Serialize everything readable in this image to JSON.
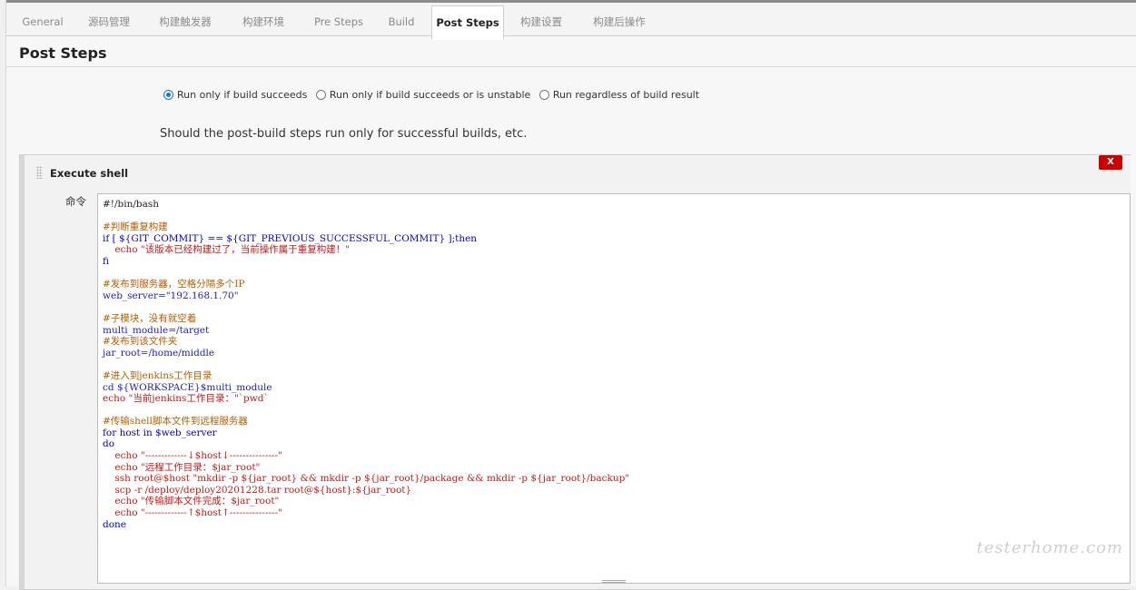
{
  "tabs": [
    {
      "label": "General",
      "active": false
    },
    {
      "label": "源码管理",
      "active": false
    },
    {
      "label": "构建触发器",
      "active": false
    },
    {
      "label": "构建环境",
      "active": false
    },
    {
      "label": "Pre Steps",
      "active": false
    },
    {
      "label": "Build",
      "active": false
    },
    {
      "label": "Post Steps",
      "active": true
    },
    {
      "label": "构建设置",
      "active": false
    },
    {
      "label": "构建后操作",
      "active": false
    }
  ],
  "section": {
    "title": "Post Steps",
    "options": [
      {
        "label": "Run only if build succeeds",
        "checked": true
      },
      {
        "label": "Run only if build succeeds or is unstable",
        "checked": false
      },
      {
        "label": "Run regardless of build result",
        "checked": false
      }
    ],
    "help": "Should the post-build steps run only for successful builds, etc."
  },
  "step": {
    "title": "Execute shell",
    "delete_label": "X",
    "command_label": "命令",
    "script_lines": [
      "#!/bin/bash",
      "",
      "#判断重复构建",
      "if [ ${GIT_COMMIT} == ${GIT_PREVIOUS_SUCCESSFUL_COMMIT} ];then",
      "    echo \"该版本已经构建过了，当前操作属于重复构建！\"",
      "fi",
      "",
      "#发布到服务器，空格分隔多个IP",
      "web_server=\"192.168.1.70\"",
      "",
      "#子模块，没有就空着",
      "multi_module=/target",
      "#发布到该文件夹",
      "jar_root=/home/middle",
      "",
      "#进入到jenkins工作目录",
      "cd ${WORKSPACE}$multi_module",
      "echo \"当前jenkins工作目录：\"`pwd`",
      "",
      "#传输shell脚本文件到远程服务器",
      "for host in $web_server",
      "do",
      "    echo \"-------------↓$host↓---------------\"",
      "    echo \"远程工作目录：$jar_root\"",
      "    ssh root@$host \"mkdir -p ${jar_root} && mkdir -p ${jar_root}/package && mkdir -p ${jar_root}/backup\"",
      "    scp -r /deploy/deploy20201228.tar root@${host}:${jar_root}",
      "    echo \"传输脚本文件完成：$jar_root\"",
      "    echo \"-------------↑$host↑---------------\"",
      "done"
    ]
  },
  "watermark": "testerhome.com"
}
